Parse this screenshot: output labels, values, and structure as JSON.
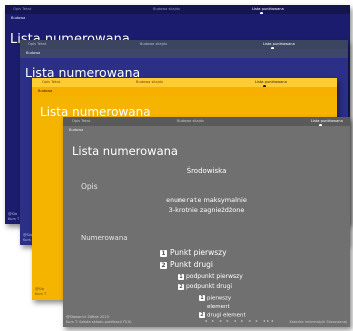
{
  "nav": {
    "items": [
      "Opis Tekst",
      "Budowa sliajdu",
      "Lista punktowana"
    ]
  },
  "subtitle": "Budowa",
  "slides": [
    {
      "title": "Lista numerowana",
      "footer_line1": "@Sla",
      "footer_line2": "Kurs T"
    },
    {
      "title": "Lista numerowana",
      "footer_line1": "@Sla",
      "footer_line2": "Kurs T"
    },
    {
      "title": "Lista numerowana",
      "footer_line1": "@Sla",
      "footer_line2": "Kurs T"
    },
    {
      "title": "Lista numerowana",
      "section_heading": "Środowiska",
      "opis_label": "Opis",
      "opis_code": "enumerate",
      "opis_text_1": " maksymalnie",
      "opis_text_2": "3-krotnie zagnieżdżone",
      "numerowana_label": "Numerowana",
      "list": [
        {
          "n": "1",
          "text": "Punkt pierwszy"
        },
        {
          "n": "2",
          "text": "Punkt drugi"
        }
      ],
      "sublist": [
        {
          "n": "1",
          "text": "podpunkt pierwszy"
        },
        {
          "n": "2",
          "text": "podpunkt drugi"
        }
      ],
      "subsublist": [
        {
          "n": "1",
          "text_1": "pierwszy",
          "text_2": "element"
        },
        {
          "n": "2",
          "text": "drugi element"
        }
      ],
      "footer_line1": "@Sławomir Żółtak 2015",
      "footer_line2": "Kurs T: Szkoła składu publikacji fT(X)",
      "footer_right": "Katedra Informatyki Stosowanej",
      "nav_symbols": "◂ ▸ ◂ ▸ ◂ ▸ ◂ ▸ ◂▸◂"
    }
  ]
}
